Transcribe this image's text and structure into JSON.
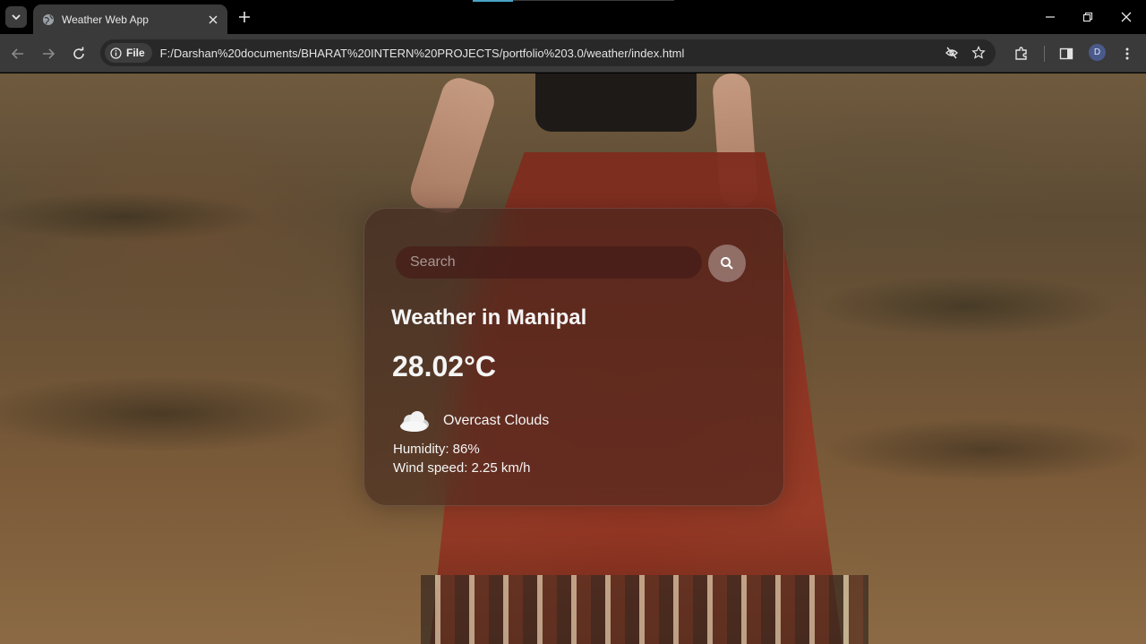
{
  "browser": {
    "tab_title": "Weather Web App",
    "file_chip": "File",
    "url": "F:/Darshan%20documents/BHARAT%20INTERN%20PROJECTS/portfolio%203.0/weather/index.html",
    "profile_initial": "D"
  },
  "weather": {
    "search_placeholder": "Search",
    "city_heading": "Weather in Manipal",
    "temperature": "28.02°C",
    "description": "Overcast Clouds",
    "humidity": "Humidity: 86%",
    "wind": "Wind speed: 2.25 km/h",
    "icon": "cloud-icon"
  },
  "colors": {
    "chrome_tabbar": "#000000",
    "chrome_toolbar": "#3a3a3a",
    "card_text": "#f5f5f5"
  }
}
